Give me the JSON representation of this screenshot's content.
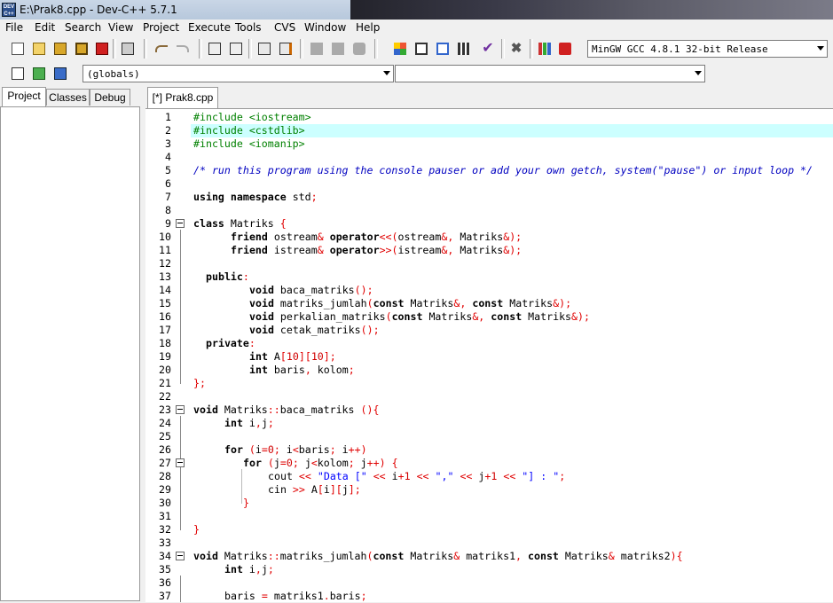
{
  "window": {
    "title": "E:\\Prak8.cpp - Dev-C++ 5.7.1",
    "icon_label": "DEV C++"
  },
  "menu": [
    "File",
    "Edit",
    "Search",
    "View",
    "Project",
    "Execute",
    "Tools",
    "CVS",
    "Window",
    "Help"
  ],
  "toolbar": {
    "compiler_select": "MinGW GCC 4.8.1 32-bit Release",
    "scope_select": "(globals)",
    "member_select": ""
  },
  "left_tabs": [
    "Project",
    "Classes",
    "Debug"
  ],
  "editor_tab": "[*] Prak8.cpp",
  "colors": {
    "highlight_line": "#ccffff",
    "preprocessor": "#008000",
    "comment": "#0000c0",
    "symbol": "#e00000",
    "string": "#0000ff"
  },
  "highlighted_line": 2,
  "code_lines": [
    {
      "n": "1",
      "indent": 0,
      "t": [
        [
          "pp",
          "#include <iostream>"
        ]
      ]
    },
    {
      "n": "2",
      "indent": 0,
      "t": [
        [
          "pp",
          "#include <cstdlib>"
        ]
      ]
    },
    {
      "n": "3",
      "indent": 0,
      "t": [
        [
          "pp",
          "#include <iomanip>"
        ]
      ]
    },
    {
      "n": "4",
      "indent": 0,
      "t": []
    },
    {
      "n": "5",
      "indent": 0,
      "t": [
        [
          "cm",
          "/* run this program using the console pauser or add your own getch, system(\"pause\") or input loop */"
        ]
      ]
    },
    {
      "n": "6",
      "indent": 0,
      "t": []
    },
    {
      "n": "7",
      "indent": 0,
      "t": [
        [
          "kw",
          "using namespace "
        ],
        [
          "",
          "std"
        ],
        [
          "sym",
          ";"
        ]
      ]
    },
    {
      "n": "8",
      "indent": 0,
      "t": []
    },
    {
      "n": "9",
      "indent": 0,
      "fold": true,
      "t": [
        [
          "kw",
          "class "
        ],
        [
          "",
          "Matriks "
        ],
        [
          "sym",
          "{"
        ]
      ]
    },
    {
      "n": "10",
      "indent": 6,
      "t": [
        [
          "kw",
          "friend "
        ],
        [
          "",
          "ostream"
        ],
        [
          "sym",
          "& "
        ],
        [
          "kw",
          "operator"
        ],
        [
          "sym",
          "<<("
        ],
        [
          "",
          "ostream"
        ],
        [
          "sym",
          "&, "
        ],
        [
          "",
          "Matriks"
        ],
        [
          "sym",
          "&);"
        ]
      ]
    },
    {
      "n": "11",
      "indent": 6,
      "t": [
        [
          "kw",
          "friend "
        ],
        [
          "",
          "istream"
        ],
        [
          "sym",
          "& "
        ],
        [
          "kw",
          "operator"
        ],
        [
          "sym",
          ">>("
        ],
        [
          "",
          "istream"
        ],
        [
          "sym",
          "&, "
        ],
        [
          "",
          "Matriks"
        ],
        [
          "sym",
          "&);"
        ]
      ]
    },
    {
      "n": "12",
      "indent": 0,
      "t": []
    },
    {
      "n": "13",
      "indent": 2,
      "t": [
        [
          "kw",
          "public"
        ],
        [
          "sym",
          ":"
        ]
      ]
    },
    {
      "n": "14",
      "indent": 9,
      "t": [
        [
          "kw",
          "void "
        ],
        [
          "",
          "baca_matriks"
        ],
        [
          "sym",
          "();"
        ]
      ]
    },
    {
      "n": "15",
      "indent": 9,
      "t": [
        [
          "kw",
          "void "
        ],
        [
          "",
          "matriks_jumlah"
        ],
        [
          "sym",
          "("
        ],
        [
          "kw",
          "const "
        ],
        [
          "",
          "Matriks"
        ],
        [
          "sym",
          "&, "
        ],
        [
          "kw",
          "const "
        ],
        [
          "",
          "Matriks"
        ],
        [
          "sym",
          "&);"
        ]
      ]
    },
    {
      "n": "16",
      "indent": 9,
      "t": [
        [
          "kw",
          "void "
        ],
        [
          "",
          "perkalian_matriks"
        ],
        [
          "sym",
          "("
        ],
        [
          "kw",
          "const "
        ],
        [
          "",
          "Matriks"
        ],
        [
          "sym",
          "&, "
        ],
        [
          "kw",
          "const "
        ],
        [
          "",
          "Matriks"
        ],
        [
          "sym",
          "&);"
        ]
      ]
    },
    {
      "n": "17",
      "indent": 9,
      "t": [
        [
          "kw",
          "void "
        ],
        [
          "",
          "cetak_matriks"
        ],
        [
          "sym",
          "();"
        ]
      ]
    },
    {
      "n": "18",
      "indent": 2,
      "t": [
        [
          "kw",
          "private"
        ],
        [
          "sym",
          ":"
        ]
      ]
    },
    {
      "n": "19",
      "indent": 9,
      "t": [
        [
          "kw",
          "int "
        ],
        [
          "",
          "A"
        ],
        [
          "sym",
          "["
        ],
        [
          "num",
          "10"
        ],
        [
          "sym",
          "]["
        ],
        [
          "num",
          "10"
        ],
        [
          "sym",
          "];"
        ]
      ]
    },
    {
      "n": "20",
      "indent": 9,
      "t": [
        [
          "kw",
          "int "
        ],
        [
          "",
          "baris"
        ],
        [
          "sym",
          ", "
        ],
        [
          "",
          "kolom"
        ],
        [
          "sym",
          ";"
        ]
      ]
    },
    {
      "n": "21",
      "indent": 0,
      "t": [
        [
          "sym",
          "};"
        ]
      ]
    },
    {
      "n": "22",
      "indent": 0,
      "t": []
    },
    {
      "n": "23",
      "indent": 0,
      "fold": true,
      "t": [
        [
          "kw",
          "void "
        ],
        [
          "",
          "Matriks"
        ],
        [
          "sym",
          "::"
        ],
        [
          "",
          "baca_matriks "
        ],
        [
          "sym",
          "(){"
        ]
      ]
    },
    {
      "n": "24",
      "indent": 5,
      "t": [
        [
          "kw",
          "int "
        ],
        [
          "",
          "i"
        ],
        [
          "sym",
          ","
        ],
        [
          "",
          "j"
        ],
        [
          "sym",
          ";"
        ]
      ]
    },
    {
      "n": "25",
      "indent": 0,
      "t": []
    },
    {
      "n": "26",
      "indent": 5,
      "t": [
        [
          "kw",
          "for "
        ],
        [
          "sym",
          "("
        ],
        [
          "",
          "i"
        ],
        [
          "sym",
          "="
        ],
        [
          "num",
          "0"
        ],
        [
          "sym",
          "; "
        ],
        [
          "",
          "i"
        ],
        [
          "sym",
          "<"
        ],
        [
          "",
          "baris"
        ],
        [
          "sym",
          "; "
        ],
        [
          "",
          "i"
        ],
        [
          "sym",
          "++)"
        ]
      ]
    },
    {
      "n": "27",
      "indent": 8,
      "fold": true,
      "t": [
        [
          "kw",
          "for "
        ],
        [
          "sym",
          "("
        ],
        [
          "",
          "j"
        ],
        [
          "sym",
          "="
        ],
        [
          "num",
          "0"
        ],
        [
          "sym",
          "; "
        ],
        [
          "",
          "j"
        ],
        [
          "sym",
          "<"
        ],
        [
          "",
          "kolom"
        ],
        [
          "sym",
          "; "
        ],
        [
          "",
          "j"
        ],
        [
          "sym",
          "++) {"
        ]
      ]
    },
    {
      "n": "28",
      "indent": 12,
      "t": [
        [
          "",
          "cout "
        ],
        [
          "sym",
          "<< "
        ],
        [
          "str",
          "\"Data [\" "
        ],
        [
          "sym",
          "<< "
        ],
        [
          "",
          "i"
        ],
        [
          "sym",
          "+"
        ],
        [
          "num",
          "1 "
        ],
        [
          "sym",
          "<< "
        ],
        [
          "str",
          "\",\" "
        ],
        [
          "sym",
          "<< "
        ],
        [
          "",
          "j"
        ],
        [
          "sym",
          "+"
        ],
        [
          "num",
          "1 "
        ],
        [
          "sym",
          "<< "
        ],
        [
          "str",
          "\"] : \""
        ],
        [
          "sym",
          ";"
        ]
      ]
    },
    {
      "n": "29",
      "indent": 12,
      "t": [
        [
          "",
          "cin "
        ],
        [
          "sym",
          ">> "
        ],
        [
          "",
          "A"
        ],
        [
          "sym",
          "["
        ],
        [
          "",
          "i"
        ],
        [
          "sym",
          "]["
        ],
        [
          "",
          "j"
        ],
        [
          "sym",
          "];"
        ]
      ]
    },
    {
      "n": "30",
      "indent": 8,
      "t": [
        [
          "sym",
          "}"
        ]
      ]
    },
    {
      "n": "31",
      "indent": 0,
      "t": []
    },
    {
      "n": "32",
      "indent": 0,
      "t": [
        [
          "sym",
          "}"
        ]
      ]
    },
    {
      "n": "33",
      "indent": 0,
      "t": []
    },
    {
      "n": "34",
      "indent": 0,
      "fold": true,
      "t": [
        [
          "kw",
          "void "
        ],
        [
          "",
          "Matriks"
        ],
        [
          "sym",
          "::"
        ],
        [
          "",
          "matriks_jumlah"
        ],
        [
          "sym",
          "("
        ],
        [
          "kw",
          "const "
        ],
        [
          "",
          "Matriks"
        ],
        [
          "sym",
          "& "
        ],
        [
          "",
          "matriks1"
        ],
        [
          "sym",
          ", "
        ],
        [
          "kw",
          "const "
        ],
        [
          "",
          "Matriks"
        ],
        [
          "sym",
          "& "
        ],
        [
          "",
          "matriks2"
        ],
        [
          "sym",
          "){"
        ]
      ]
    },
    {
      "n": "35",
      "indent": 5,
      "t": [
        [
          "kw",
          "int "
        ],
        [
          "",
          "i"
        ],
        [
          "sym",
          ","
        ],
        [
          "",
          "j"
        ],
        [
          "sym",
          ";"
        ]
      ]
    },
    {
      "n": "36",
      "indent": 0,
      "t": []
    },
    {
      "n": "37",
      "indent": 5,
      "t": [
        [
          "",
          "baris "
        ],
        [
          "sym",
          "= "
        ],
        [
          "",
          "matriks1"
        ],
        [
          "sym",
          "."
        ],
        [
          "",
          "baris"
        ],
        [
          "sym",
          ";"
        ]
      ]
    }
  ]
}
